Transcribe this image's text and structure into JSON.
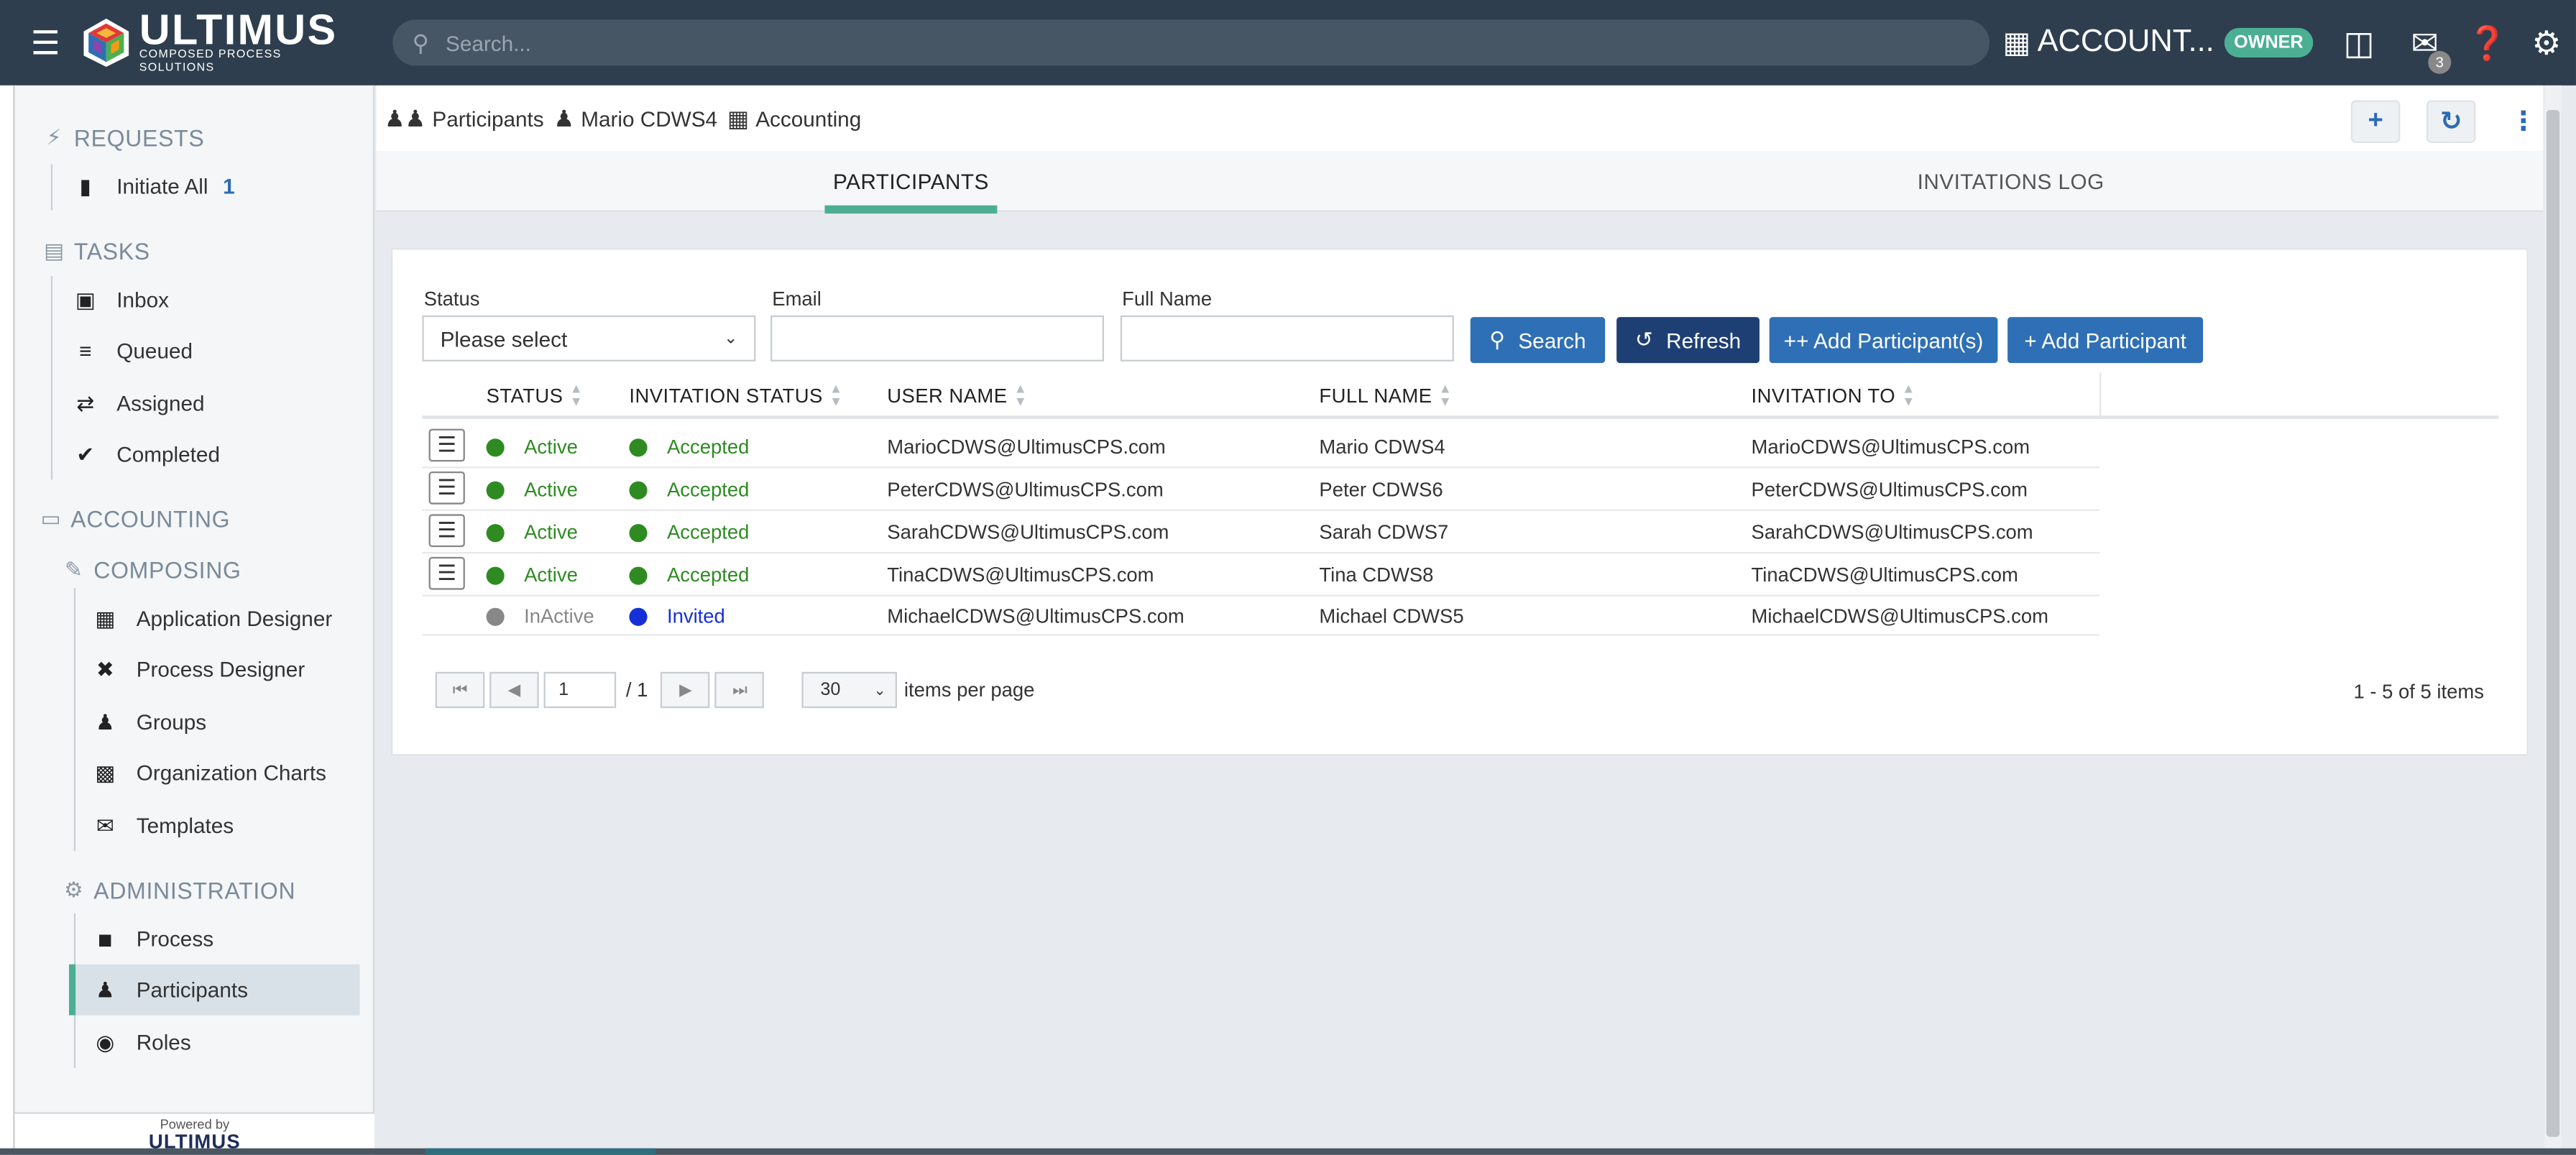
{
  "topbar": {
    "logo_title": "ULTIMUS",
    "logo_sub": "COMPOSED PROCESS SOLUTIONS",
    "search_placeholder": "Search...",
    "account_label": "ACCOUNT...",
    "owner_badge": "OWNER",
    "mail_count": "3"
  },
  "sidebar": {
    "requests": {
      "label": "REQUESTS",
      "items": [
        {
          "label": "Initiate All",
          "count": "1"
        }
      ]
    },
    "tasks": {
      "label": "TASKS",
      "items": [
        {
          "label": "Inbox"
        },
        {
          "label": "Queued"
        },
        {
          "label": "Assigned"
        },
        {
          "label": "Completed"
        }
      ]
    },
    "accounting": {
      "label": "ACCOUNTING"
    },
    "composing": {
      "label": "COMPOSING",
      "items": [
        {
          "label": "Application Designer"
        },
        {
          "label": "Process Designer"
        },
        {
          "label": "Groups"
        },
        {
          "label": "Organization Charts"
        },
        {
          "label": "Templates"
        }
      ]
    },
    "administration": {
      "label": "ADMINISTRATION",
      "items": [
        {
          "label": "Process"
        },
        {
          "label": "Participants"
        },
        {
          "label": "Roles"
        }
      ]
    },
    "powered_by": "Powered by",
    "powered_logo": "ULTIMUS"
  },
  "breadcrumb": [
    "Participants",
    "Mario CDWS4",
    "Accounting"
  ],
  "tabs": [
    {
      "label": "PARTICIPANTS",
      "active": true
    },
    {
      "label": "INVITATIONS LOG",
      "active": false
    }
  ],
  "filters": {
    "status_label": "Status",
    "status_value": "Please select",
    "email_label": "Email",
    "email_value": "",
    "fullname_label": "Full Name",
    "fullname_value": "",
    "search_btn": "Search",
    "refresh_btn": "Refresh",
    "add_multi_btn": "++ Add Participant(s)",
    "add_btn": "+ Add Participant"
  },
  "table": {
    "columns": [
      "STATUS",
      "INVITATION STATUS",
      "USER NAME",
      "FULL NAME",
      "INVITATION TO"
    ],
    "rows": [
      {
        "status": "Active",
        "invitation_status": "Accepted",
        "user_name": "MarioCDWS@UltimusCPS.com",
        "full_name": "Mario CDWS4",
        "invitation_to": "MarioCDWS@UltimusCPS.com"
      },
      {
        "status": "Active",
        "invitation_status": "Accepted",
        "user_name": "PeterCDWS@UltimusCPS.com",
        "full_name": "Peter CDWS6",
        "invitation_to": "PeterCDWS@UltimusCPS.com"
      },
      {
        "status": "Active",
        "invitation_status": "Accepted",
        "user_name": "SarahCDWS@UltimusCPS.com",
        "full_name": "Sarah CDWS7",
        "invitation_to": "SarahCDWS@UltimusCPS.com"
      },
      {
        "status": "Active",
        "invitation_status": "Accepted",
        "user_name": "TinaCDWS@UltimusCPS.com",
        "full_name": "Tina CDWS8",
        "invitation_to": "TinaCDWS@UltimusCPS.com"
      },
      {
        "status": "InActive",
        "invitation_status": "Invited",
        "user_name": "MichaelCDWS@UltimusCPS.com",
        "full_name": "Michael CDWS5",
        "invitation_to": "MichaelCDWS@UltimusCPS.com"
      }
    ]
  },
  "pager": {
    "page": "1",
    "total_pages": "/ 1",
    "per_page": "30",
    "per_page_label": "items per page",
    "info": "1 - 5 of 5 items"
  },
  "colors": {
    "topbar": "#2e3e4e",
    "accent": "#4caf94",
    "primary_button": "#2f6fb5",
    "refresh_button": "#1d3f73",
    "active_dot": "#2e8b22",
    "invited_dot": "#1530d6",
    "inactive_dot": "#888888"
  }
}
